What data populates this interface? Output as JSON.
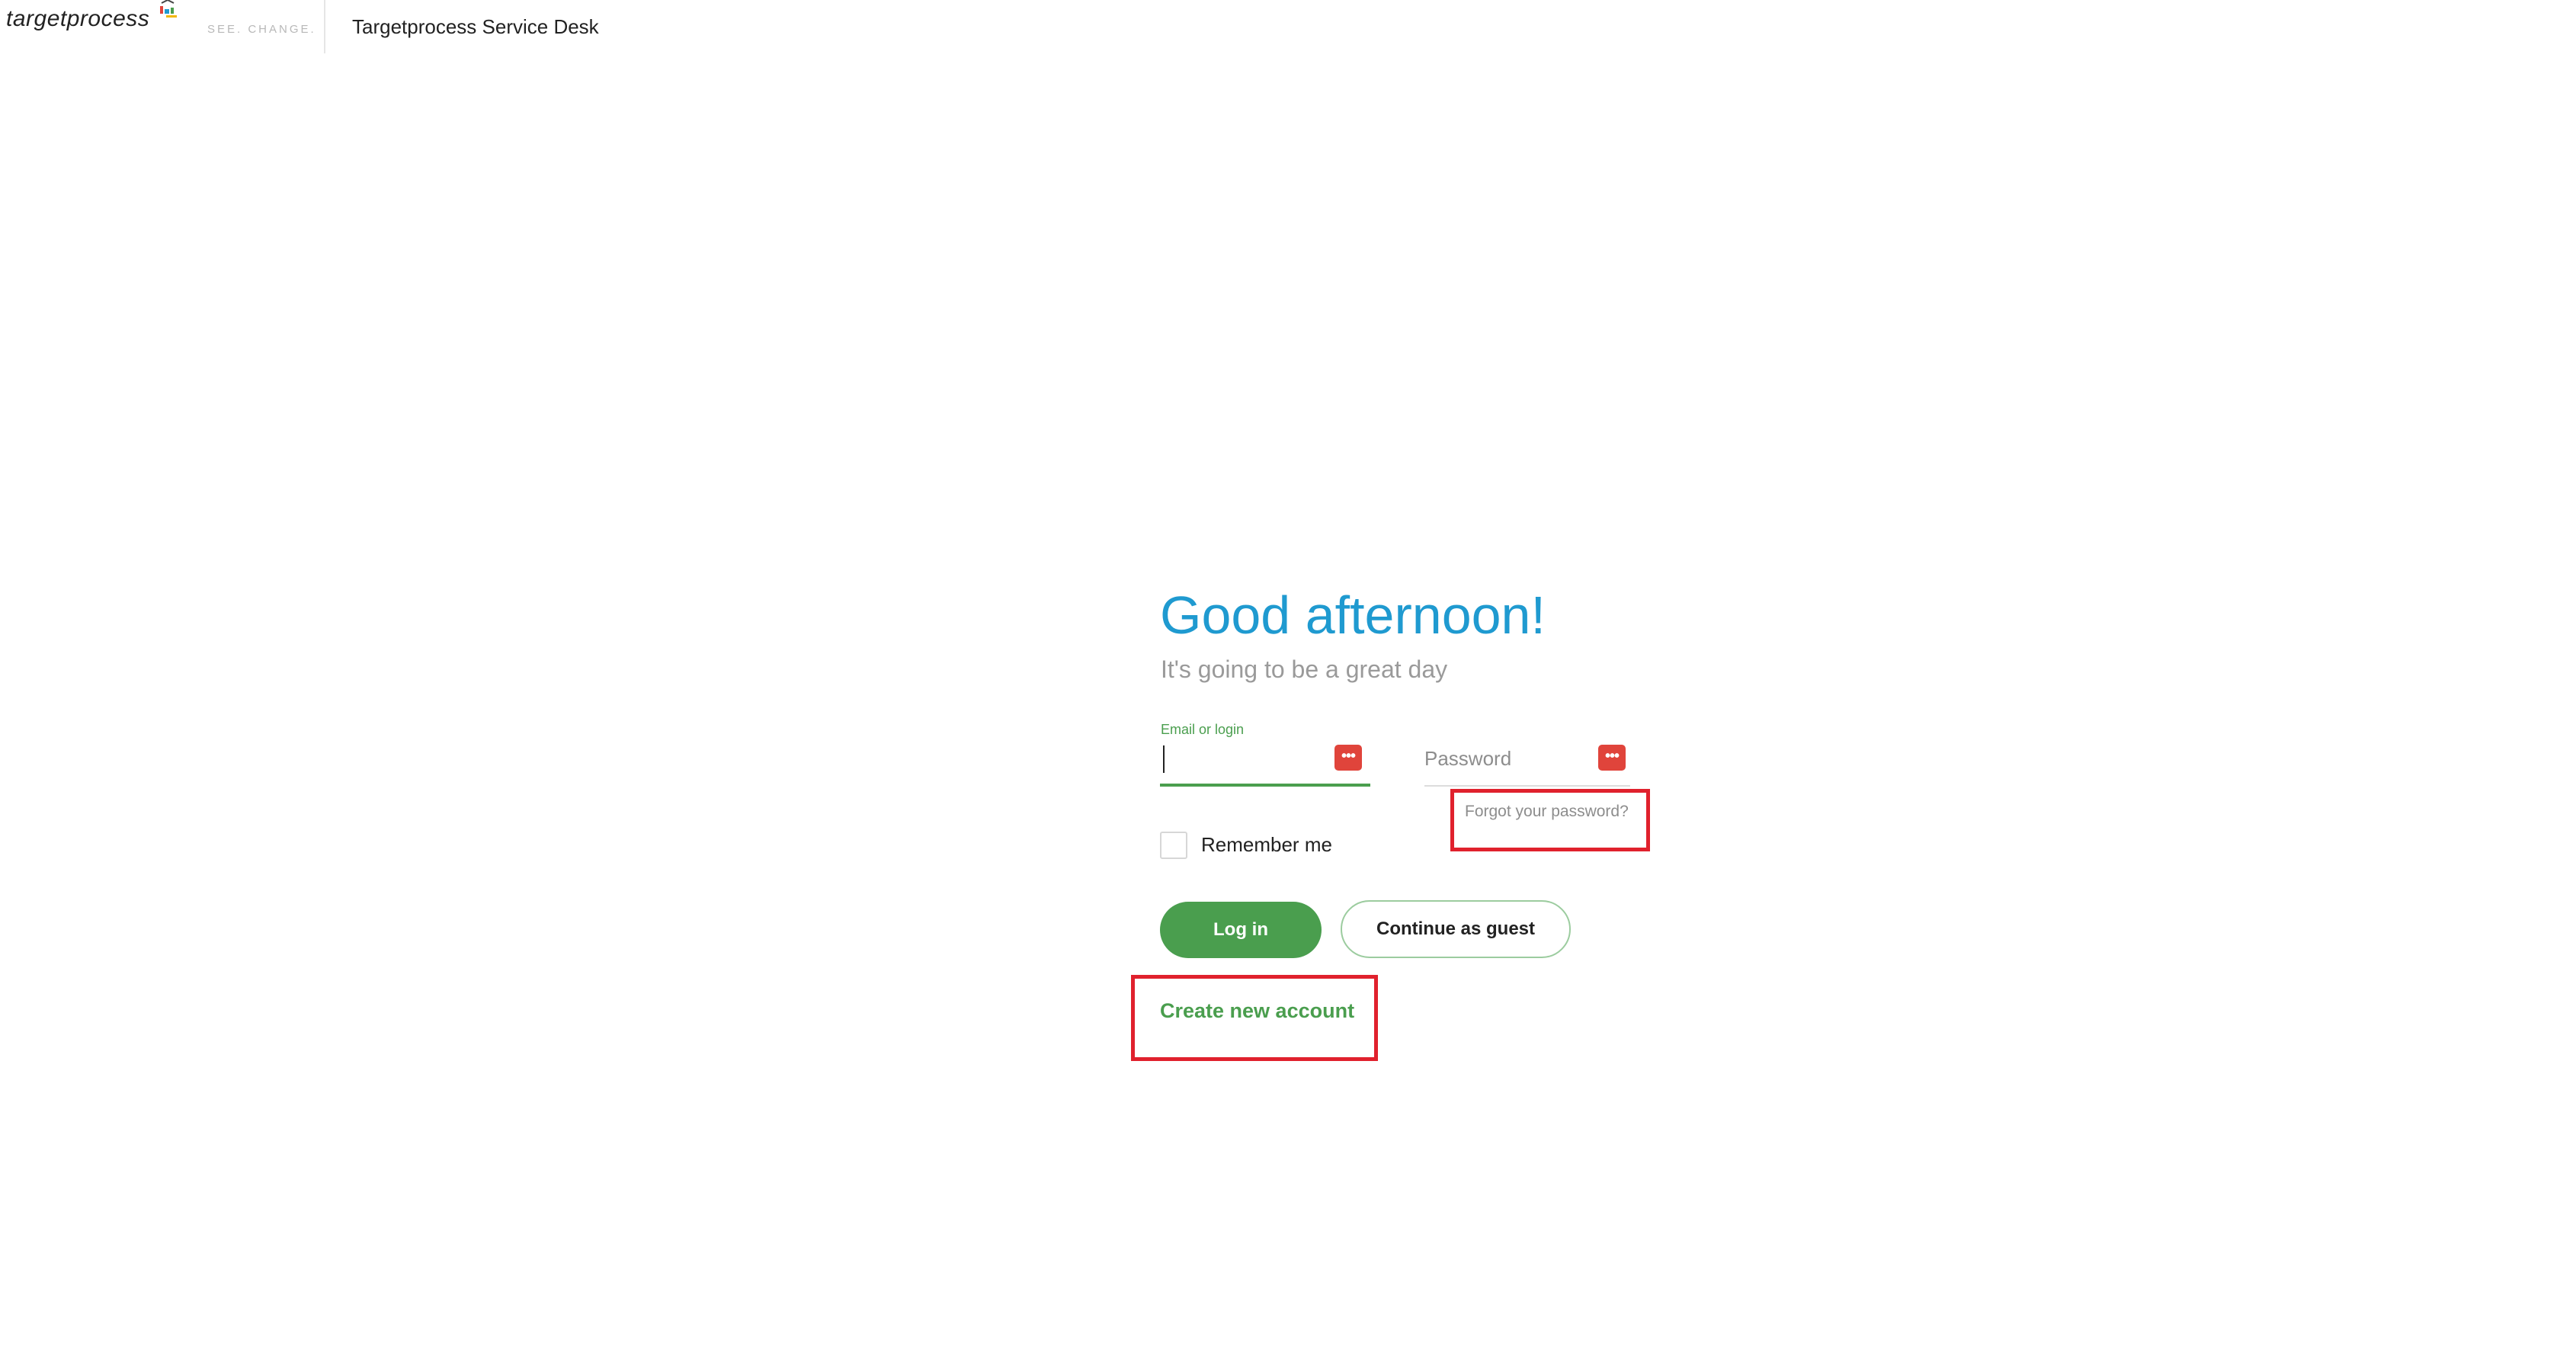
{
  "header": {
    "logo_text": "targetprocess",
    "tagline": "SEE. CHANGE.",
    "app_title": "Targetprocess Service Desk"
  },
  "login": {
    "greeting": "Good afternoon!",
    "subgreeting": "It's going to be a great day",
    "email_label": "Email or login",
    "email_value": "",
    "password_placeholder": "Password",
    "forgot_password": "Forgot your password?",
    "remember_me": "Remember me",
    "remember_checked": false,
    "login_button": "Log in",
    "guest_button": "Continue as guest",
    "create_account": "Create new account"
  },
  "colors": {
    "accent_green": "#4a9e4e",
    "greeting_blue": "#1f9ad0",
    "highlight_red": "#e0212d",
    "password_manager_red": "#e0443b"
  },
  "icons": {
    "password_manager": "password-manager-icon",
    "logo_mark": "targetprocess-logo-mark"
  }
}
